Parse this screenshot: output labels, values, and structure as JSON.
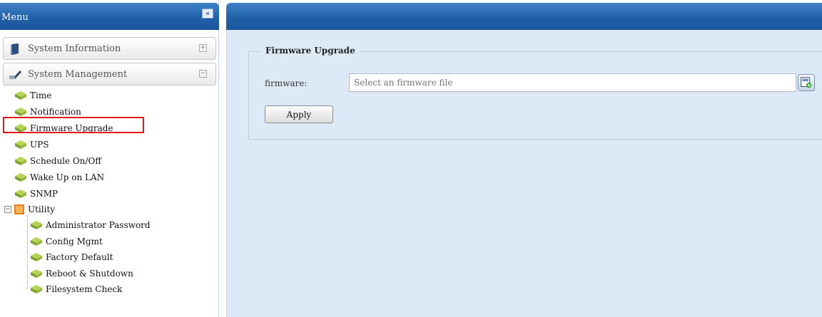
{
  "menu": {
    "title": "Menu",
    "collapse_symbol": "«",
    "sections": [
      {
        "label": "System Information",
        "toggle": "+"
      },
      {
        "label": "System Management",
        "toggle": "−"
      }
    ],
    "items": [
      {
        "label": "Time"
      },
      {
        "label": "Notification"
      },
      {
        "label": "Firmware Upgrade"
      },
      {
        "label": "UPS"
      },
      {
        "label": "Schedule On/Off"
      },
      {
        "label": "Wake Up on LAN"
      },
      {
        "label": "SNMP"
      }
    ],
    "utility": {
      "label": "Utility",
      "toggle": "−",
      "children": [
        {
          "label": "Administrator Password"
        },
        {
          "label": "Config Mgmt"
        },
        {
          "label": "Factory Default"
        },
        {
          "label": "Reboot & Shutdown"
        },
        {
          "label": "Filesystem Check"
        }
      ]
    }
  },
  "content": {
    "section_title": "Firmware Upgrade",
    "firmware_label": "firmware:",
    "firmware_placeholder": "Select an firmware file",
    "firmware_value": "",
    "apply_label": "Apply"
  },
  "colors": {
    "header_blue": "#1f5fa8",
    "content_bg": "#dde9f7",
    "highlight_red": "#e2161b",
    "leaf_green": "#8db43a"
  }
}
